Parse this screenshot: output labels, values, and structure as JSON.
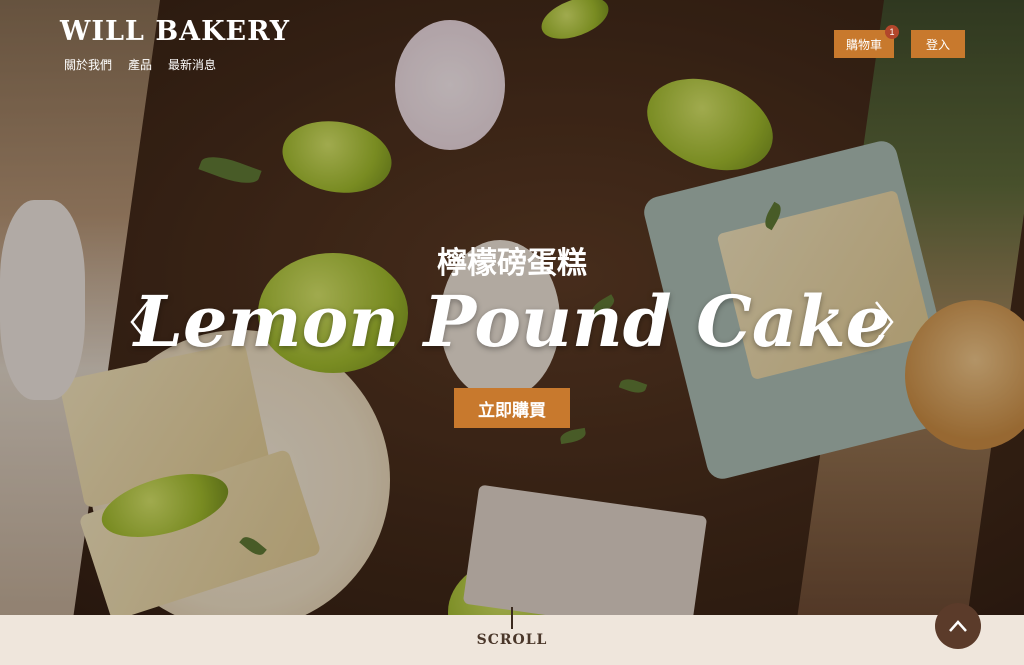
{
  "header": {
    "brand": "WILL BAKERY",
    "nav": [
      "關於我們",
      "產品",
      "最新消息"
    ],
    "cart_label": "購物車",
    "cart_count": "1",
    "login_label": "登入"
  },
  "hero": {
    "subtitle": "檸檬磅蛋糕",
    "title": "Lemon Pound Cake",
    "cta_label": "立即購買"
  },
  "footer": {
    "scroll_label": "SCROLL"
  },
  "icons": {
    "prev": "chevron-left-icon",
    "next": "chevron-right-icon",
    "totop": "chevron-up-icon"
  },
  "colors": {
    "accent": "#c8792d",
    "badge": "#b2462b",
    "footer_bg": "#efe6dc",
    "totop_bg": "#5b3b2a"
  }
}
